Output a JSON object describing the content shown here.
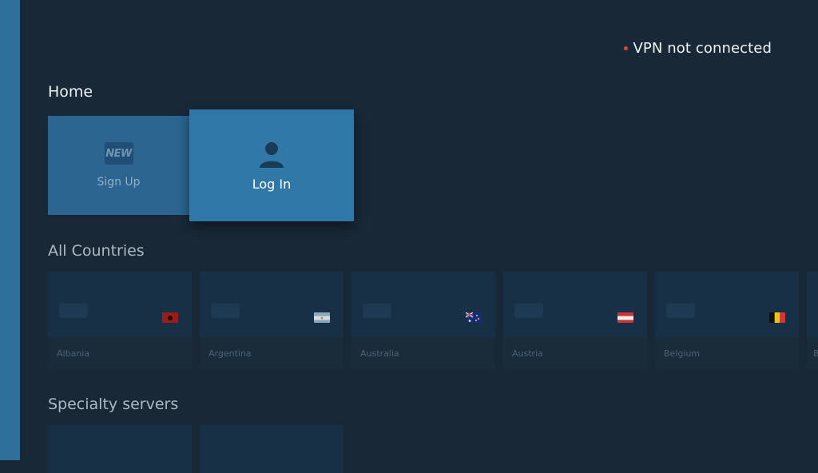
{
  "status": {
    "text": "VPN not connected",
    "dot_color": "#e2463b"
  },
  "home": {
    "title": "Home",
    "signup": {
      "label": "Sign Up",
      "badge": "NEW"
    },
    "login": {
      "label": "Log In"
    }
  },
  "countries": {
    "title": "All Countries",
    "items": [
      {
        "name": "Albania"
      },
      {
        "name": "Argentina"
      },
      {
        "name": "Australia"
      },
      {
        "name": "Austria"
      },
      {
        "name": "Belgium"
      },
      {
        "name": "B"
      }
    ]
  },
  "specialty": {
    "title": "Specialty servers"
  }
}
